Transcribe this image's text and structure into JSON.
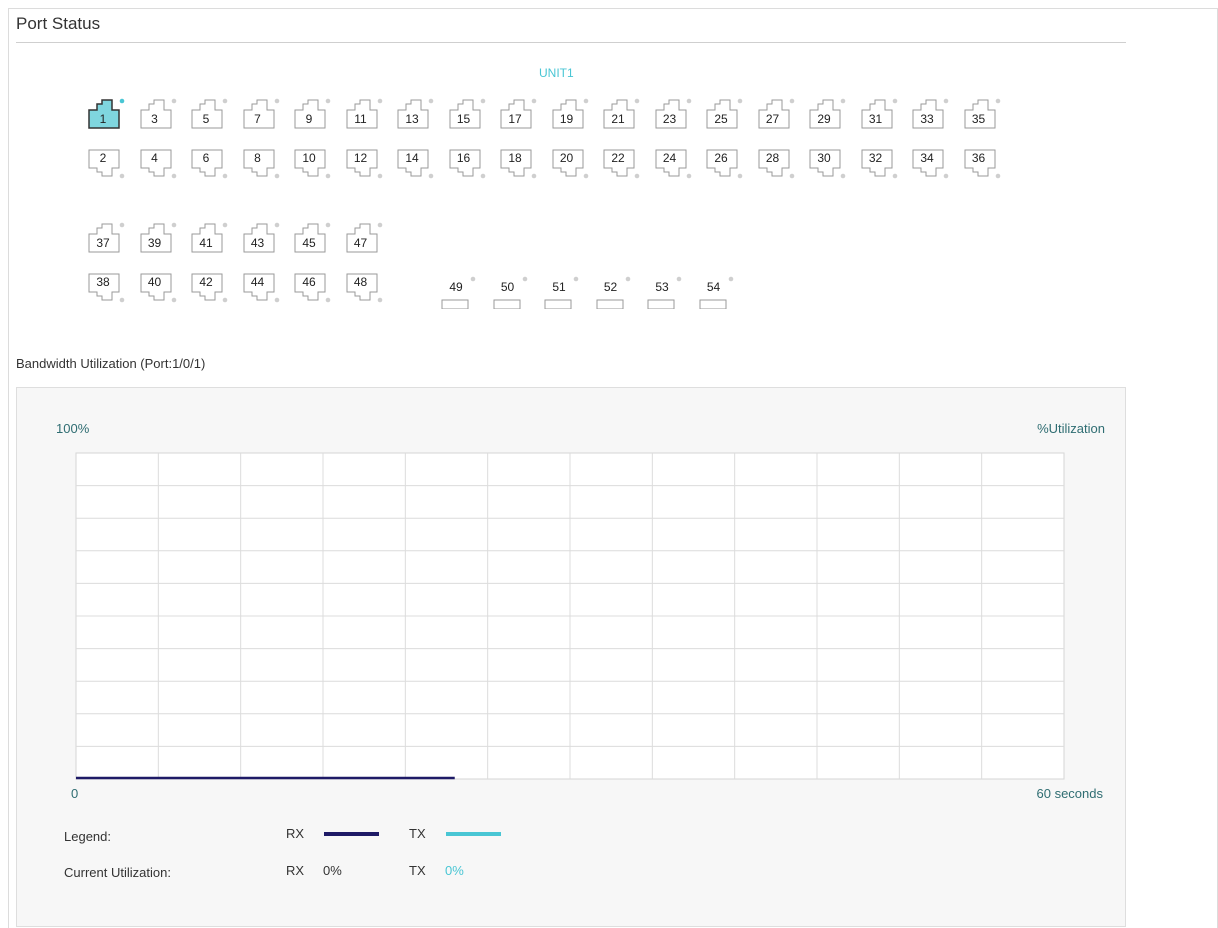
{
  "page": {
    "title": "Port Status"
  },
  "unit": {
    "label": "UNIT1"
  },
  "ports": {
    "selected": "1",
    "row1": [
      "1",
      "3",
      "5",
      "7",
      "9",
      "11",
      "13",
      "15",
      "17",
      "19",
      "21",
      "23",
      "25",
      "27",
      "29",
      "31",
      "33",
      "35"
    ],
    "row2": [
      "2",
      "4",
      "6",
      "8",
      "10",
      "12",
      "14",
      "16",
      "18",
      "20",
      "22",
      "24",
      "26",
      "28",
      "30",
      "32",
      "34",
      "36"
    ],
    "row3": [
      "37",
      "39",
      "41",
      "43",
      "45",
      "47"
    ],
    "row4": [
      "38",
      "40",
      "42",
      "44",
      "46",
      "48"
    ],
    "sfp": [
      "49",
      "50",
      "51",
      "52",
      "53",
      "54"
    ]
  },
  "bandwidth": {
    "title": "Bandwidth Utilization (Port:1/0/1)",
    "legend_label": "Legend:",
    "current_label": "Current Utilization:",
    "rx_label": "RX",
    "tx_label": "TX",
    "rx_value": "0%",
    "tx_value": "0%"
  },
  "chart_data": {
    "type": "line",
    "y_top_label": "100%",
    "y_axis_label": "%Utilization",
    "x_start_label": "0",
    "x_end_label": "60 seconds",
    "xlim": [
      0,
      60
    ],
    "ylim": [
      0,
      100
    ],
    "series": [
      {
        "name": "RX",
        "color": "#1e1a66",
        "x": [
          0,
          23
        ],
        "y": [
          0,
          0
        ]
      },
      {
        "name": "TX",
        "color": "#49c6d4",
        "x": [],
        "y": []
      }
    ]
  },
  "colors": {
    "accent": "#49c6d4",
    "rx": "#1e1a66",
    "tx": "#49c6d4",
    "axis_text": "#2f6d72",
    "selected_port": "#7fd6df"
  }
}
